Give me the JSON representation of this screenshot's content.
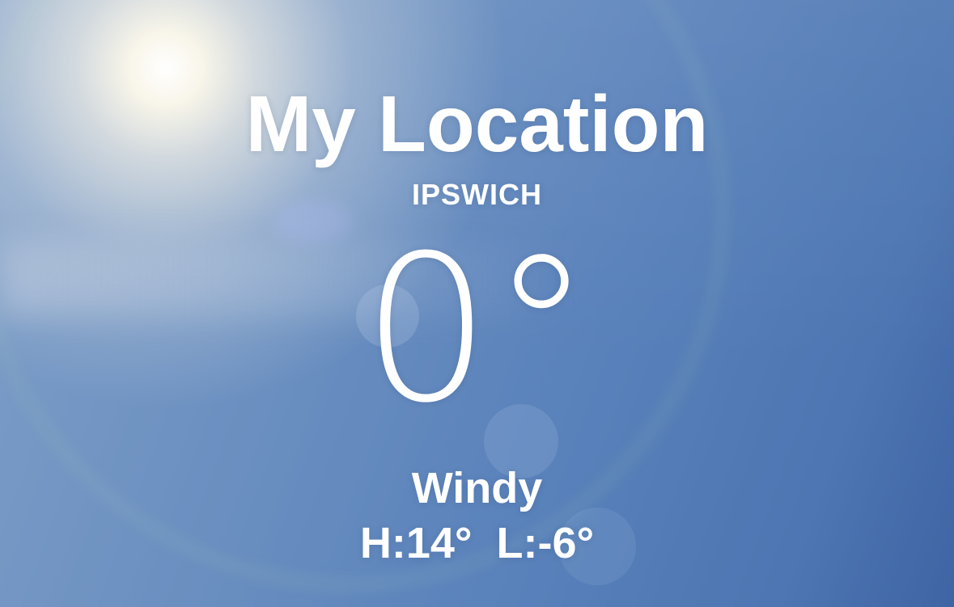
{
  "header": {
    "title": "My Location",
    "city": "IPSWICH"
  },
  "current": {
    "temperature": "0°",
    "condition": "Windy",
    "high": "H:14°",
    "low": "L:-6°"
  },
  "colors": {
    "sky_light": "#7f9fc8",
    "sky_dark": "#3f64a3",
    "text": "#ffffff"
  }
}
